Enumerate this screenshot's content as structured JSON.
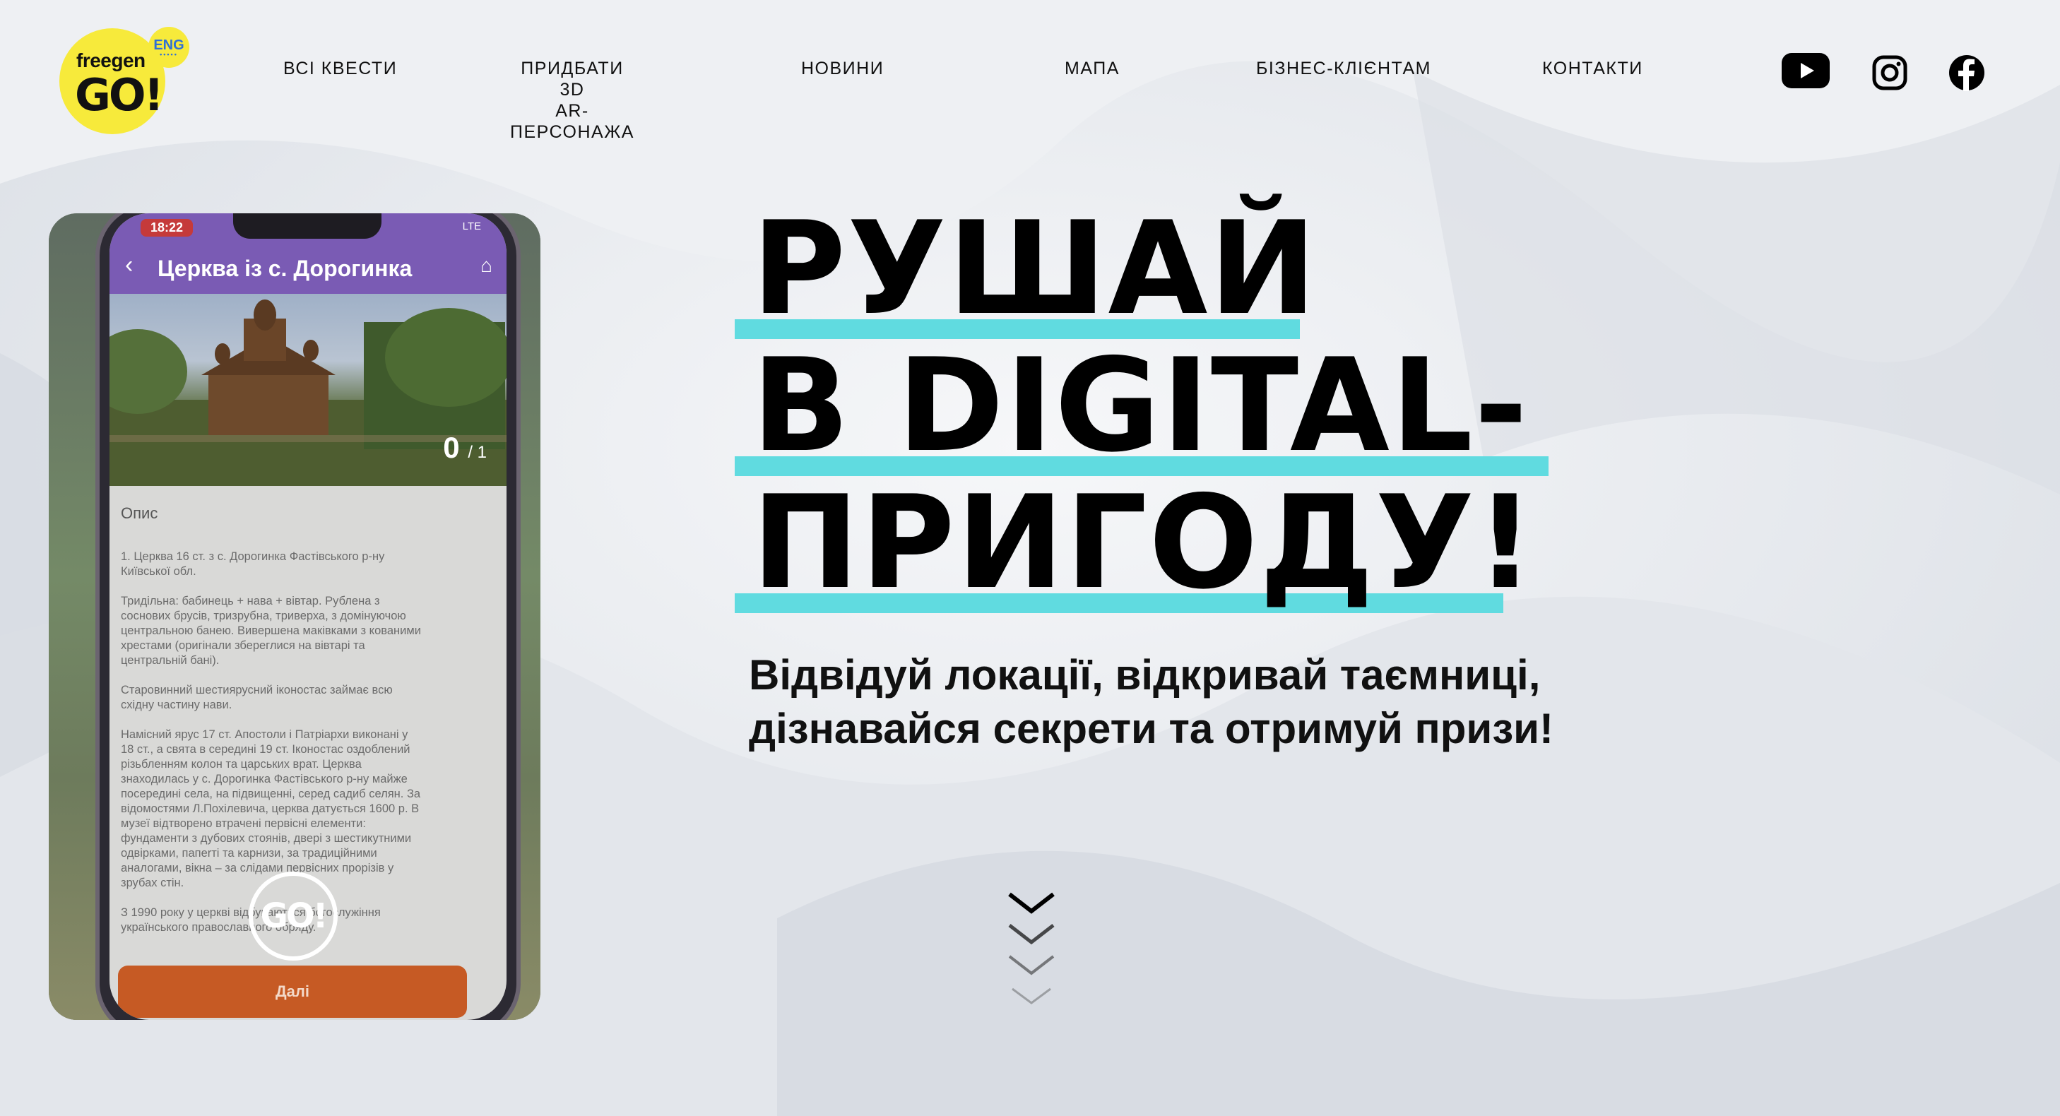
{
  "header": {
    "logo": {
      "brand": "freegen",
      "go": "GO!",
      "lang": "ENG"
    },
    "nav": [
      {
        "label": "ВСІ КВЕСТИ"
      },
      {
        "label": "ПРИДБАТИ 3D\nAR-ПЕРСОНАЖА"
      },
      {
        "label": "НОВИНИ"
      },
      {
        "label": "МАПА"
      },
      {
        "label": "БІЗНЕС-КЛІЄНТАМ"
      },
      {
        "label": "КОНТАКТИ"
      }
    ],
    "social_icons": [
      "youtube-icon",
      "instagram-icon",
      "facebook-icon"
    ]
  },
  "phone": {
    "status_time": "18:22",
    "status_network": "LTE",
    "app_title": "Церква із с. Дорогинка",
    "photo_counter": "0",
    "photo_total": "/ 1",
    "description_title": "Опис",
    "description_text": "1. Церква 16 ст. з с. Дорогинка Фастівського р-ну\nКиївської обл.\n\nТридільна: бабинець + нава + вівтар. Рублена з\nсоснових брусів, тризрубна, триверха, з домінуючою\nцентральною банею. Вивершена маківками з кованими\nхрестами (оригінали збереглися на вівтарі та\nцентральній бані).\n\nСтаровинний шестиярусний іконостас займає всю\nсхідну частину нави.\n\nНамісний ярус 17 ст. Апостоли і Патріархи виконані у\n18 ст., а свята в середині 19 ст. Іконостас оздоблений\nрізьбленням колон та царських врат. Церква\nзнаходилась у с. Дорогинка Фастівського р-ну майже\nпосередині села, на підвищенні, серед садиб селян. За\nвідомостями Л.Похілевича, церква датується 1600 р. В\nмузеї відтворено втрачені первісні елементи:\nфундаменти з дубових стоянів, двері з шестикутними\nодвірками, папerті та карнизи, за традиційними\nаналогами, вікна – за слідами первісних прорізів у\nзрубах стін.\n\nЗ 1990 року у церкві відбуваються богослужіння\nукраїнського православного обряду.",
    "next_button": "Далі",
    "go_badge": "GO!"
  },
  "hero": {
    "line1": "РУШАЙ",
    "line2": "В DIGITAL-",
    "line3": "ПРИГОДУ!",
    "subtitle_line1": "Відвідуй локації, відкривай таємниці,",
    "subtitle_line2": "дізнавайся секрети та отримуй призи!"
  },
  "colors": {
    "accent_cyan": "#60dbe0",
    "logo_yellow": "#f7ea3b",
    "app_purple": "#7a5bb4",
    "button_orange": "#c65a24"
  },
  "scroll_indicator": "chevrons-down-icon"
}
